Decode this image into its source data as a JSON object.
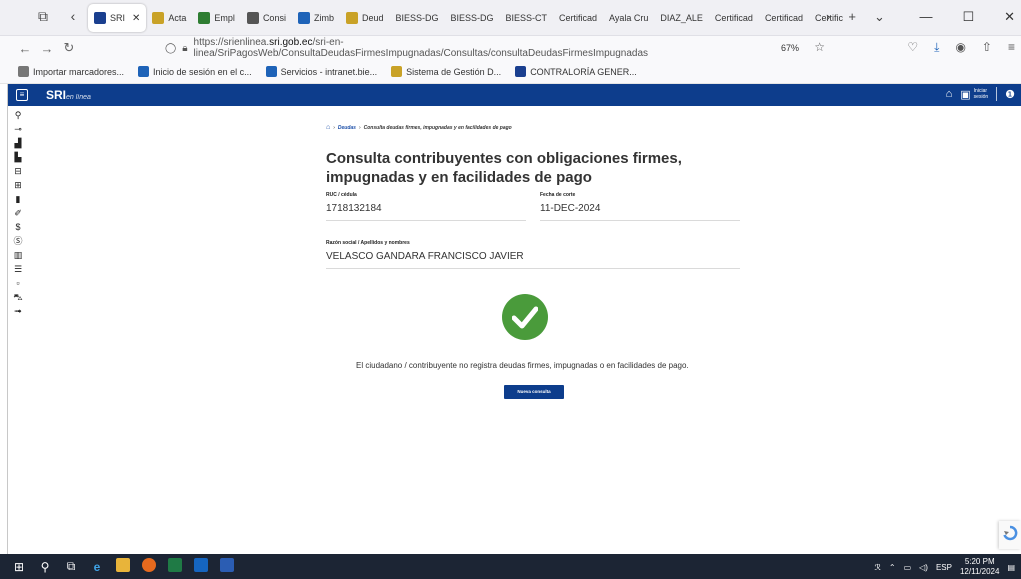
{
  "browser": {
    "tabs": [
      {
        "label": "SRI",
        "color": "#1a3f8f",
        "active": true
      },
      {
        "label": "Acta",
        "color": "#c9a227"
      },
      {
        "label": "Empl",
        "color": "#2e7d32"
      },
      {
        "label": "Consi",
        "color": "#555555"
      },
      {
        "label": "Zimb",
        "color": "#1e63b8"
      },
      {
        "label": "Deud",
        "color": "#c9a227"
      },
      {
        "label": "BIESS-DG",
        "color": ""
      },
      {
        "label": "BIESS-DG",
        "color": ""
      },
      {
        "label": "BIESS-CT",
        "color": ""
      },
      {
        "label": "Certificad",
        "color": ""
      },
      {
        "label": "Ayala Cru",
        "color": ""
      },
      {
        "label": "DIAZ_ALE",
        "color": ""
      },
      {
        "label": "Certificad",
        "color": ""
      },
      {
        "label": "Certificad",
        "color": ""
      },
      {
        "label": "Certific",
        "color": ""
      }
    ],
    "url_prefix": "https://srienlinea.",
    "url_host": "sri.gob.ec",
    "url_path": "/sri-en-linea/SriPagosWeb/ConsultaDeudasFirmesImpugnadas/Consultas/consultaDeudasFirmesImpugnadas",
    "zoom": "67%",
    "bookmarks": [
      {
        "label": "Importar marcadores...",
        "color": "#777777"
      },
      {
        "label": "Inicio de sesión en el c...",
        "color": "#1e63b8"
      },
      {
        "label": "Servicios - intranet.bie...",
        "color": "#1e63b8"
      },
      {
        "label": "Sistema de Gestión D...",
        "color": "#c9a227"
      },
      {
        "label": "CONTRALORÍA GENER...",
        "color": "#1a3f8f"
      }
    ]
  },
  "header": {
    "logo": "SRI",
    "logo_sub": "en línea",
    "login_label_1": "Iniciar",
    "login_label_2": "sesión"
  },
  "breadcrumb": {
    "link": "Deudas",
    "current": "Consulta deudas firmes, impugnadas y en facilidades de pago"
  },
  "page": {
    "title": "Consulta contribuyentes con obligaciones firmes, impugnadas y en facilidades de pago",
    "ruc_label": "RUC / cédula",
    "ruc_value": "1718132184",
    "fecha_label": "Fecha de corte",
    "fecha_value": "11-DEC-2024",
    "razon_label": "Razón social / Apellidos y nombres",
    "razon_value": "VELASCO GANDARA FRANCISCO JAVIER",
    "message": "El ciudadano / contribuyente no registra deudas firmes, impugnadas o en facilidades de pago.",
    "button": "Nueva consulta"
  },
  "taskbar": {
    "lang": "ESP",
    "time": "5:20 PM",
    "date": "12/11/2024"
  },
  "colors": {
    "brand": "#0d3d8c",
    "success": "#4a9b3b"
  }
}
